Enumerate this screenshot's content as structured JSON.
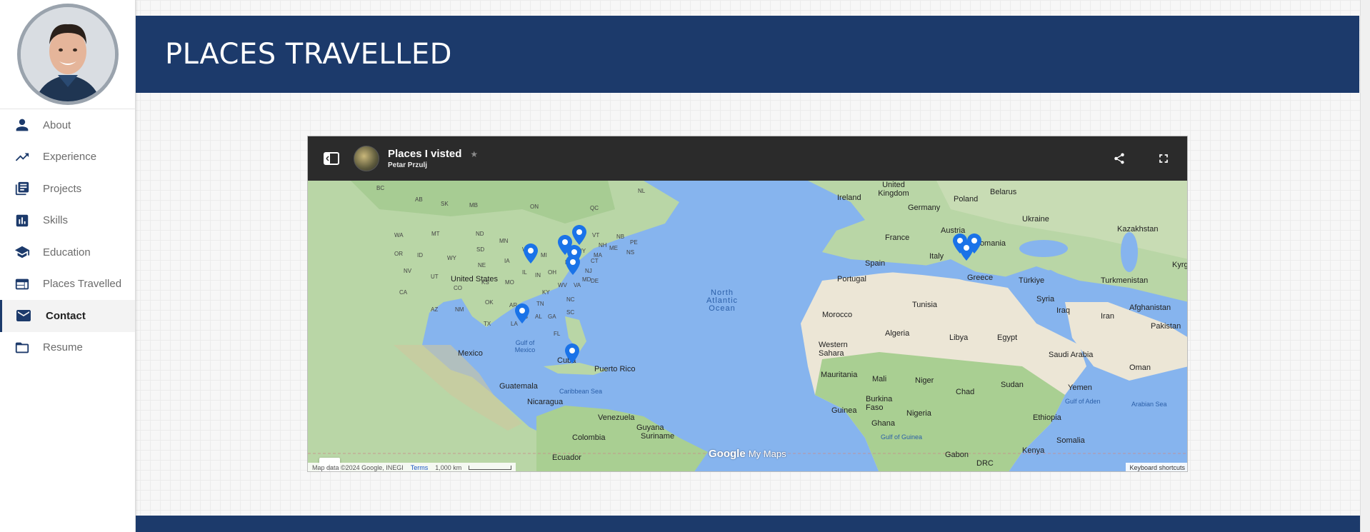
{
  "sidebar": {
    "items": [
      {
        "label": "About",
        "icon": "person-icon"
      },
      {
        "label": "Experience",
        "icon": "trending-up-icon"
      },
      {
        "label": "Projects",
        "icon": "library-books-icon"
      },
      {
        "label": "Skills",
        "icon": "bar-chart-icon"
      },
      {
        "label": "Education",
        "icon": "school-icon"
      },
      {
        "label": "Places Travelled",
        "icon": "web-icon"
      },
      {
        "label": "Contact",
        "icon": "mail-icon",
        "active": true
      },
      {
        "label": "Resume",
        "icon": "folder-icon"
      }
    ]
  },
  "header": {
    "title": "PLACES TRAVELLED"
  },
  "map": {
    "title": "Places I visted",
    "author": "Petar Przulj",
    "labels": [
      {
        "text": "United Kingdom"
      },
      {
        "text": "Ireland"
      },
      {
        "text": "Belarus"
      },
      {
        "text": "Poland"
      },
      {
        "text": "Germany"
      },
      {
        "text": "Ukraine"
      },
      {
        "text": "Kazakhstan"
      },
      {
        "text": "Austria"
      },
      {
        "text": "France"
      },
      {
        "text": "Romania"
      },
      {
        "text": "Italy"
      },
      {
        "text": "Spain"
      },
      {
        "text": "Portugal"
      },
      {
        "text": "Greece"
      },
      {
        "text": "Türkiye"
      },
      {
        "text": "Turkmenistan"
      },
      {
        "text": "Kyrg"
      },
      {
        "text": "Syria"
      },
      {
        "text": "Iraq"
      },
      {
        "text": "Afghanistan"
      },
      {
        "text": "Iran"
      },
      {
        "text": "Pakistan"
      },
      {
        "text": "Tunisia"
      },
      {
        "text": "Morocco"
      },
      {
        "text": "Algeria"
      },
      {
        "text": "Libya"
      },
      {
        "text": "Egypt"
      },
      {
        "text": "Western Sahara"
      },
      {
        "text": "Saudi Arabia"
      },
      {
        "text": "Oman"
      },
      {
        "text": "Mauritania"
      },
      {
        "text": "Mali"
      },
      {
        "text": "Niger"
      },
      {
        "text": "Sudan"
      },
      {
        "text": "Yemen"
      },
      {
        "text": "Chad"
      },
      {
        "text": "Burkina Faso"
      },
      {
        "text": "Guinea"
      },
      {
        "text": "Nigeria"
      },
      {
        "text": "Ghana"
      },
      {
        "text": "Ethiopia"
      },
      {
        "text": "Somalia"
      },
      {
        "text": "Kenya"
      },
      {
        "text": "Gabon"
      },
      {
        "text": "DRC"
      },
      {
        "text": "Gulf of Aden"
      },
      {
        "text": "Arabian Sea"
      },
      {
        "text": "Gulf of Guinea"
      },
      {
        "text": "United States"
      },
      {
        "text": "Mexico"
      },
      {
        "text": "Cuba"
      },
      {
        "text": "Puerto Rico"
      },
      {
        "text": "Guatemala"
      },
      {
        "text": "Nicaragua"
      },
      {
        "text": "Venezuela"
      },
      {
        "text": "Guyana"
      },
      {
        "text": "Suriname"
      },
      {
        "text": "Colombia"
      },
      {
        "text": "Ecuador"
      },
      {
        "text": "Gulf of Mexico"
      },
      {
        "text": "Caribbean Sea"
      },
      {
        "text": "North Atlantic Ocean"
      }
    ],
    "state_labels": [
      "BC",
      "AB",
      "SK",
      "MB",
      "ON",
      "QC",
      "NL",
      "WA",
      "MT",
      "ND",
      "MN",
      "OR",
      "ID",
      "SD",
      "WY",
      "NE",
      "IA",
      "WI",
      "MI",
      "NV",
      "UT",
      "CO",
      "KS",
      "MO",
      "IL",
      "IN",
      "OH",
      "PA",
      "NY",
      "VT",
      "NH",
      "ME",
      "NB",
      "PE",
      "NS",
      "MA",
      "CT",
      "NJ",
      "DE",
      "MD",
      "WV",
      "VA",
      "KY",
      "TN",
      "NC",
      "SC",
      "CA",
      "AZ",
      "NM",
      "OK",
      "AR",
      "MS",
      "AL",
      "GA",
      "TX",
      "LA",
      "FL"
    ],
    "zoom_in": "+",
    "zoom_out": "−",
    "attribution": "Map data ©2024 Google, INEGI",
    "terms": "Terms",
    "scale": "1,000 km",
    "keyboard": "Keyboard shortcuts",
    "logo_google": "Google",
    "logo_mymaps": "My Maps"
  },
  "colors": {
    "navy": "#1c3a6b",
    "marker": "#1a73e8",
    "water": "#86b4ee",
    "land": "#b9d6a6"
  }
}
